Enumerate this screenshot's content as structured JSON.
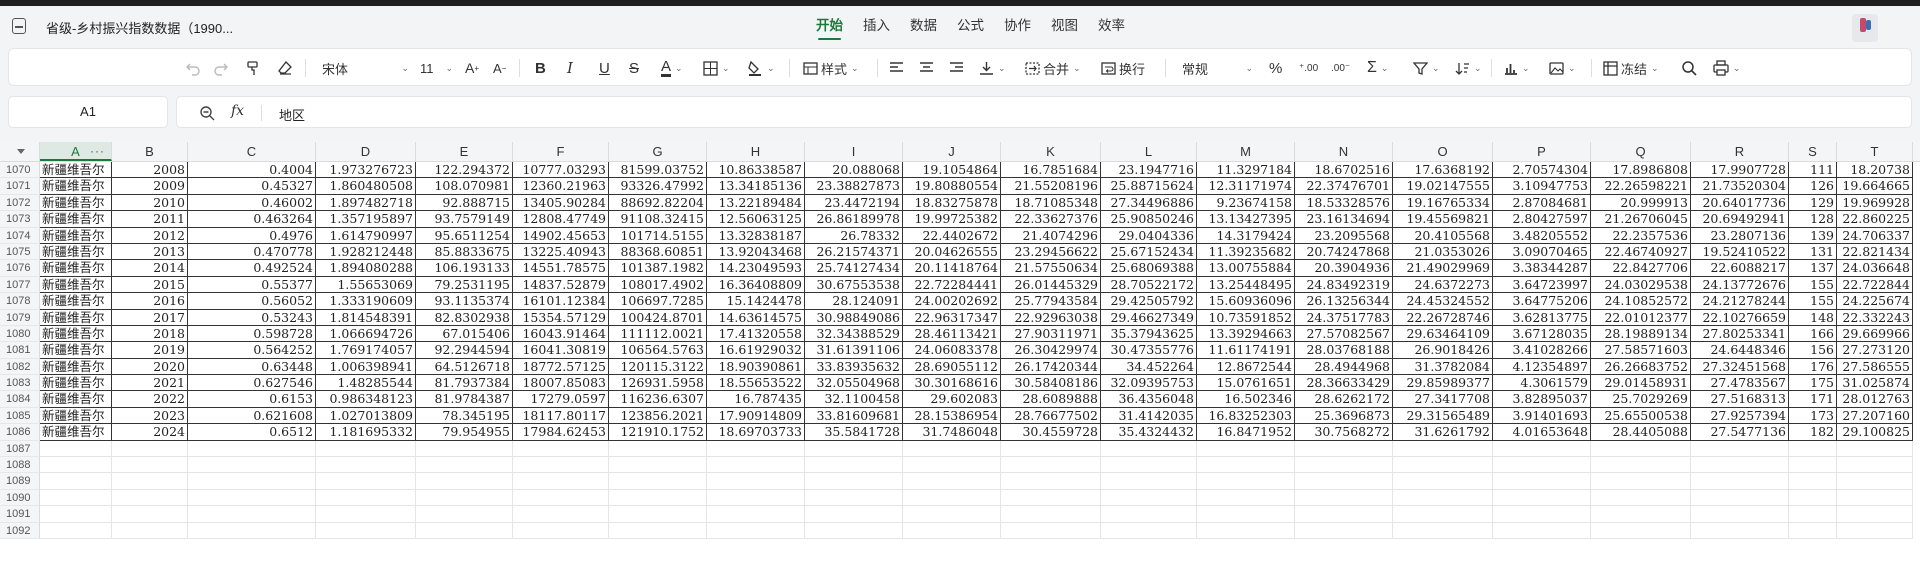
{
  "window": {
    "doc_title": "省级-乡村振兴指数数据（1990..."
  },
  "menu": {
    "items": [
      "开始",
      "插入",
      "数据",
      "公式",
      "协作",
      "视图",
      "效率"
    ],
    "active": "开始"
  },
  "toolbar": {
    "font_name": "宋体",
    "font_size": "11",
    "style_label": "样式",
    "merge_label": "合并",
    "wrap_label": "换行",
    "number_format": "常规",
    "freeze_label": "冻结"
  },
  "formula_bar": {
    "cell_ref": "A1",
    "fx_label": "fx",
    "value": "地区"
  },
  "sheet": {
    "columns": [
      "A",
      "B",
      "C",
      "D",
      "E",
      "F",
      "G",
      "H",
      "I",
      "J",
      "K",
      "L",
      "M",
      "N",
      "O",
      "P",
      "Q",
      "R",
      "S",
      "T"
    ],
    "selected_column": "A",
    "column_more": "···",
    "rows": [
      {
        "n": "1070",
        "cells": [
          "新疆维吾尔",
          "2008",
          "0.4004",
          "1.973276723",
          "122.294372",
          "10777.03293",
          "81599.03752",
          "10.86338587",
          "20.088068",
          "19.1054864",
          "16.7851684",
          "23.1947716",
          "11.3297184",
          "18.6702516",
          "17.6368192",
          "2.70574304",
          "17.8986808",
          "17.9907728",
          "111",
          "18.20738"
        ]
      },
      {
        "n": "1071",
        "cells": [
          "新疆维吾尔",
          "2009",
          "0.45327",
          "1.860480508",
          "108.070981",
          "12360.21963",
          "93326.47992",
          "13.34185136",
          "23.38827873",
          "19.80880554",
          "21.55208196",
          "25.88715624",
          "12.31171974",
          "22.37476701",
          "19.02147555",
          "3.10947753",
          "22.26598221",
          "21.73520304",
          "126",
          "19.664665"
        ]
      },
      {
        "n": "1072",
        "cells": [
          "新疆维吾尔",
          "2010",
          "0.46002",
          "1.897482718",
          "92.888715",
          "13405.90284",
          "88692.82204",
          "13.22189484",
          "23.4472194",
          "18.83275878",
          "18.71085348",
          "27.34496886",
          "9.23674158",
          "18.53328576",
          "19.16765334",
          "2.87084681",
          "20.999913",
          "20.64017736",
          "129",
          "19.969928"
        ]
      },
      {
        "n": "1073",
        "cells": [
          "新疆维吾尔",
          "2011",
          "0.463264",
          "1.357195897",
          "93.7579149",
          "12808.47749",
          "91108.32415",
          "12.56063125",
          "26.86189978",
          "19.99725382",
          "22.33627376",
          "25.90850246",
          "13.13427395",
          "23.16134694",
          "19.45569821",
          "2.80427597",
          "21.26706045",
          "20.69492941",
          "128",
          "22.860225"
        ]
      },
      {
        "n": "1074",
        "cells": [
          "新疆维吾尔",
          "2012",
          "0.4976",
          "1.614790997",
          "95.6511254",
          "14902.45653",
          "101714.5155",
          "13.32838187",
          "26.78332",
          "22.4402672",
          "21.4074296",
          "29.0404336",
          "14.3179424",
          "23.2095568",
          "20.4105568",
          "3.48205552",
          "22.2357536",
          "23.2807136",
          "139",
          "24.706337"
        ]
      },
      {
        "n": "1075",
        "cells": [
          "新疆维吾尔",
          "2013",
          "0.470778",
          "1.928212448",
          "85.8833675",
          "13225.40943",
          "88368.60851",
          "13.92043468",
          "26.21574371",
          "20.04626555",
          "23.29456622",
          "25.67152434",
          "11.39235682",
          "20.74247868",
          "21.0353026",
          "3.09070465",
          "22.46740927",
          "19.52410522",
          "131",
          "22.821434"
        ]
      },
      {
        "n": "1076",
        "cells": [
          "新疆维吾尔",
          "2014",
          "0.492524",
          "1.894080288",
          "106.193133",
          "14551.78575",
          "101387.1982",
          "14.23049593",
          "25.74127434",
          "20.11418764",
          "21.57550634",
          "25.68069388",
          "13.00755884",
          "20.3904936",
          "21.49029969",
          "3.38344287",
          "22.8427706",
          "22.6088217",
          "137",
          "24.036648"
        ]
      },
      {
        "n": "1077",
        "cells": [
          "新疆维吾尔",
          "2015",
          "0.55377",
          "1.55653069",
          "79.2531195",
          "14837.52879",
          "108017.4902",
          "16.36408809",
          "30.67553538",
          "22.72284441",
          "26.01445329",
          "28.70522172",
          "13.25448495",
          "24.83492319",
          "24.6372273",
          "3.64723997",
          "24.03029538",
          "24.13772676",
          "155",
          "22.722844"
        ]
      },
      {
        "n": "1078",
        "cells": [
          "新疆维吾尔",
          "2016",
          "0.56052",
          "1.333190609",
          "93.1135374",
          "16101.12384",
          "106697.7285",
          "15.1424478",
          "28.124091",
          "24.00202692",
          "25.77943584",
          "29.42505792",
          "15.60936096",
          "26.13256344",
          "24.45324552",
          "3.64775206",
          "24.10852572",
          "24.21278244",
          "155",
          "24.225674"
        ]
      },
      {
        "n": "1079",
        "cells": [
          "新疆维吾尔",
          "2017",
          "0.53243",
          "1.814548391",
          "82.8302938",
          "15354.57129",
          "100424.8701",
          "14.63614575",
          "30.98849086",
          "22.96317347",
          "22.92963038",
          "29.46627349",
          "10.73591852",
          "24.37517783",
          "22.26728746",
          "3.62813775",
          "22.01012377",
          "22.10276659",
          "148",
          "22.332243"
        ]
      },
      {
        "n": "1080",
        "cells": [
          "新疆维吾尔",
          "2018",
          "0.598728",
          "1.066694726",
          "67.015406",
          "16043.91464",
          "111112.0021",
          "17.41320558",
          "32.34388529",
          "28.46113421",
          "27.90311971",
          "35.37943625",
          "13.39294663",
          "27.57082567",
          "29.63464109",
          "3.67128035",
          "28.19889134",
          "27.80253341",
          "166",
          "29.669966"
        ]
      },
      {
        "n": "1081",
        "cells": [
          "新疆维吾尔",
          "2019",
          "0.564252",
          "1.769174057",
          "92.2944594",
          "16041.30819",
          "106564.5763",
          "16.61929032",
          "31.61391106",
          "24.06083378",
          "26.30429974",
          "30.47355776",
          "11.61174191",
          "28.03768188",
          "26.9018426",
          "3.41028266",
          "27.58571603",
          "24.6448346",
          "156",
          "27.273120"
        ]
      },
      {
        "n": "1082",
        "cells": [
          "新疆维吾尔",
          "2020",
          "0.63448",
          "1.006398941",
          "64.5126718",
          "18772.57125",
          "120115.3122",
          "18.90390861",
          "33.83935632",
          "28.69055112",
          "26.17420344",
          "34.452264",
          "12.8672544",
          "28.4944968",
          "31.3782084",
          "4.12354897",
          "26.26683752",
          "27.32451568",
          "176",
          "27.586555"
        ]
      },
      {
        "n": "1083",
        "cells": [
          "新疆维吾尔",
          "2021",
          "0.627546",
          "1.48285544",
          "81.7937384",
          "18007.85083",
          "126931.5958",
          "18.55653522",
          "32.05504968",
          "30.30168616",
          "30.58408186",
          "32.09395753",
          "15.0761651",
          "28.36633429",
          "29.85989377",
          "4.3061579",
          "29.01458931",
          "27.4783567",
          "175",
          "31.025874"
        ]
      },
      {
        "n": "1084",
        "cells": [
          "新疆维吾尔",
          "2022",
          "0.6153",
          "0.986348123",
          "81.9784387",
          "17279.0597",
          "116236.6307",
          "16.787435",
          "32.1100458",
          "29.602083",
          "28.6089888",
          "36.4356048",
          "16.502346",
          "28.6262172",
          "27.3417708",
          "3.82895037",
          "25.7029269",
          "27.5168313",
          "171",
          "28.012763"
        ]
      },
      {
        "n": "1085",
        "cells": [
          "新疆维吾尔",
          "2023",
          "0.621608",
          "1.027013809",
          "78.345195",
          "18117.80117",
          "123856.2021",
          "17.90914809",
          "33.81609681",
          "28.15386954",
          "28.76677502",
          "31.4142035",
          "16.83252303",
          "25.3696873",
          "29.31565489",
          "3.91401693",
          "25.65500538",
          "27.9257394",
          "173",
          "27.207160"
        ]
      },
      {
        "n": "1086",
        "cells": [
          "新疆维吾尔",
          "2024",
          "0.6512",
          "1.181695332",
          "79.954955",
          "17984.62453",
          "121910.1752",
          "18.69703733",
          "35.5841728",
          "31.7486048",
          "30.4559728",
          "35.4324432",
          "16.8471952",
          "30.7568272",
          "31.6261792",
          "4.01653648",
          "28.4405088",
          "27.5477136",
          "182",
          "29.100825"
        ]
      },
      {
        "n": "1087",
        "cells": []
      },
      {
        "n": "1088",
        "cells": []
      },
      {
        "n": "1089",
        "cells": []
      },
      {
        "n": "1090",
        "cells": []
      },
      {
        "n": "1091",
        "cells": []
      },
      {
        "n": "1092",
        "cells": []
      }
    ]
  },
  "colors": {
    "accent": "#1a7a3a",
    "selected_header_bg": "#dfe9e3"
  },
  "icons": [
    "document-icon",
    "undo-icon",
    "redo-icon",
    "format-painter-icon",
    "eraser-icon",
    "font-color-icon",
    "fill-color-icon",
    "border-icon",
    "align-left-icon",
    "align-center-icon",
    "align-right-icon",
    "valign-icon",
    "percent-icon",
    "sum-icon",
    "filter-icon",
    "sort-icon",
    "chart-icon",
    "image-icon",
    "freeze-icon",
    "search-icon",
    "print-icon",
    "zoom-icon"
  ]
}
